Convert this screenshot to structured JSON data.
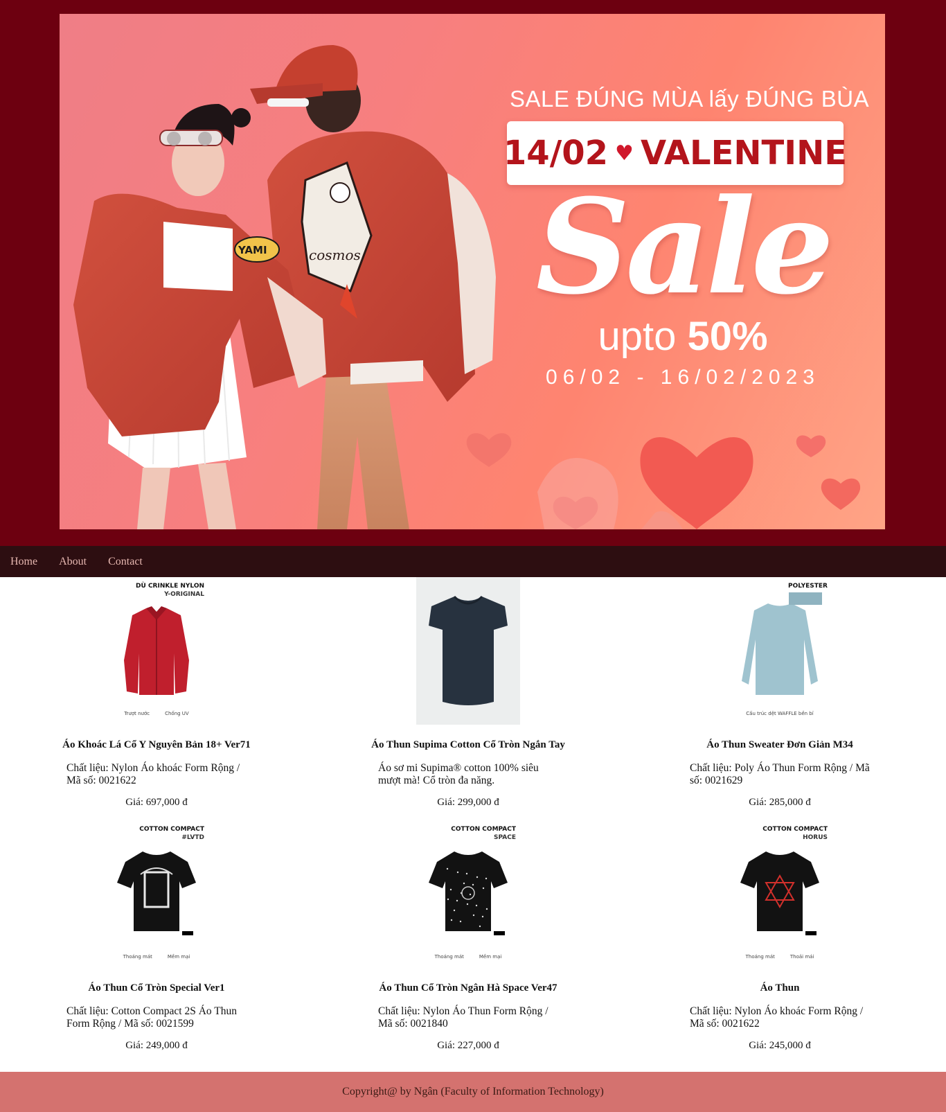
{
  "banner": {
    "tagline": "SALE ĐÚNG MÙA lấy ĐÚNG BÙA",
    "date": "14/02",
    "event": "VALENTINE",
    "sale": "Sale",
    "upto": "upto",
    "percent": "50%",
    "range": "06/02 - 16/02/2023",
    "jacket_patch_1": "YAMI",
    "jacket_patch_2": "cosmos",
    "colors": {
      "frame": "#6d0010",
      "banner_bg": "#f77f7f",
      "date_text": "#b3141b"
    }
  },
  "nav": {
    "items": [
      "Home",
      "About",
      "Contact"
    ],
    "colors": {
      "bg": "#2d0e11",
      "text": "#e6b7b0"
    }
  },
  "products": [
    {
      "name": "Áo Khoác Lá Cổ Y Nguyên Bản 18+ Ver71",
      "desc": "Chất liệu: Nylon Áo khoác Form Rộng / Mã số: 0021622",
      "price": "Giá: 697,000 đ",
      "image_tag": "DÙ CRINKLE NYLON",
      "image_sub": "Y-ORIGINAL",
      "features": [
        "Trượt nước",
        "Chống UV"
      ],
      "image_kind": "red-jacket"
    },
    {
      "name": "Áo Thun Supima Cotton Cổ Tròn Ngắn Tay",
      "desc": "Áo sơ mi Supima® cotton 100% siêu mượt mà! Cổ tròn đa năng.",
      "price": "Giá: 299,000 đ",
      "image_tag": "",
      "image_sub": "",
      "features": [],
      "image_kind": "navy-tee"
    },
    {
      "name": "Áo Thun Sweater Đơn Giản M34",
      "desc": "Chất liệu: Poly Áo Thun Form Rộng / Mã số: 0021629",
      "price": "Giá: 285,000 đ",
      "image_tag": "POLYESTER",
      "image_sub": "",
      "features": [
        "Cấu trúc dệt WAFFLE bền bỉ"
      ],
      "image_kind": "blue-sweater"
    },
    {
      "name": "Áo Thun Cổ Tròn Special Ver1",
      "desc": "Chất liệu: Cotton Compact 2S Áo Thun Form Rộng / Mã số: 0021599",
      "price": "Giá: 249,000 đ",
      "image_tag": "COTTON COMPACT",
      "image_sub": "#LVTD",
      "features": [
        "Thoáng mát",
        "Mềm mại"
      ],
      "image_kind": "black-tee-white"
    },
    {
      "name": "Áo Thun Cổ Tròn Ngân Hà Space Ver47",
      "desc": "Chất liệu: Nylon Áo Thun Form Rộng / Mã số: 0021840",
      "price": "Giá: 227,000 đ",
      "image_tag": "COTTON COMPACT",
      "image_sub": "SPACE",
      "features": [
        "Thoáng mát",
        "Mềm mại"
      ],
      "image_kind": "black-tee-space"
    },
    {
      "name": "Áo Thun",
      "desc": "Chất liệu: Nylon Áo khoác Form Rộng / Mã số: 0021622",
      "price": "Giá: 245,000 đ",
      "image_tag": "COTTON COMPACT",
      "image_sub": "HORUS",
      "features": [
        "Thoáng mát",
        "Thoải mái"
      ],
      "image_kind": "black-tee-red"
    }
  ],
  "footer": {
    "text": "Copyright@ by Ngân (Faculty of Information Technology)",
    "colors": {
      "bg": "#d4726f"
    }
  }
}
